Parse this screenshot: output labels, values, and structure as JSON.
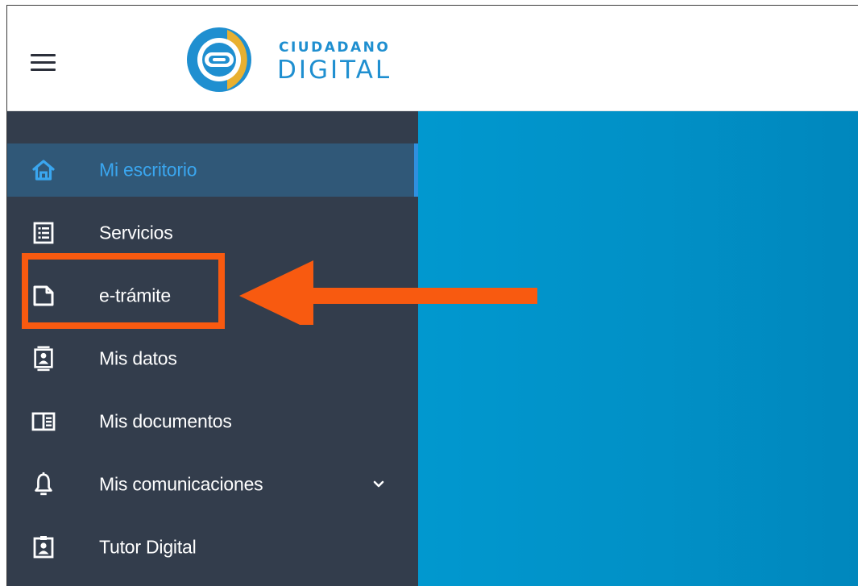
{
  "app": {
    "logo_line1": "CIUDADANO",
    "logo_line2": "DIGITAL"
  },
  "header": {
    "menu_icon": "hamburger-icon"
  },
  "sidebar": {
    "items": [
      {
        "label": "Mi escritorio",
        "icon": "home-icon",
        "active": true
      },
      {
        "label": "Servicios",
        "icon": "list-icon",
        "active": false
      },
      {
        "label": "e-trámite",
        "icon": "document-icon",
        "active": false
      },
      {
        "label": "Mis datos",
        "icon": "contact-card-icon",
        "active": false
      },
      {
        "label": "Mis documentos",
        "icon": "book-icon",
        "active": false
      },
      {
        "label": "Mis comunicaciones",
        "icon": "bell-icon",
        "active": false,
        "has_submenu": true
      },
      {
        "label": "Tutor Digital",
        "icon": "badge-icon",
        "active": false
      }
    ]
  },
  "colors": {
    "sidebar_bg": "#333d4c",
    "active_bg": "#305878",
    "active_text": "#3aa6ef",
    "content_bg": "#0193c9",
    "annotation": "#f85a10",
    "logo_blue": "#1f8fd0",
    "logo_gold": "#e8b030"
  }
}
